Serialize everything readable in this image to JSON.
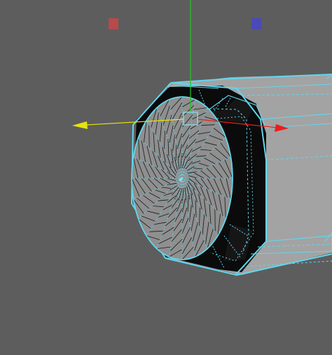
{
  "viewport": {
    "background": "#5d5d5d"
  },
  "object": {
    "selection_color": "#62d6ee",
    "body_fill": "#a3a3a3",
    "interior_fill": "#0b0b0b",
    "cap_fill": "#8f8f8f",
    "hatch_color": "#1a1a1a"
  },
  "gizmo": {
    "axis_x_color": "#ef1c1c",
    "axis_y_color": "#22c722",
    "axis_z_color": "#e9e40b",
    "center_handle_color": "#8fdcec"
  },
  "axis_handles": {
    "x_color": "#b84a4a",
    "z_color": "#4a4ab8"
  }
}
